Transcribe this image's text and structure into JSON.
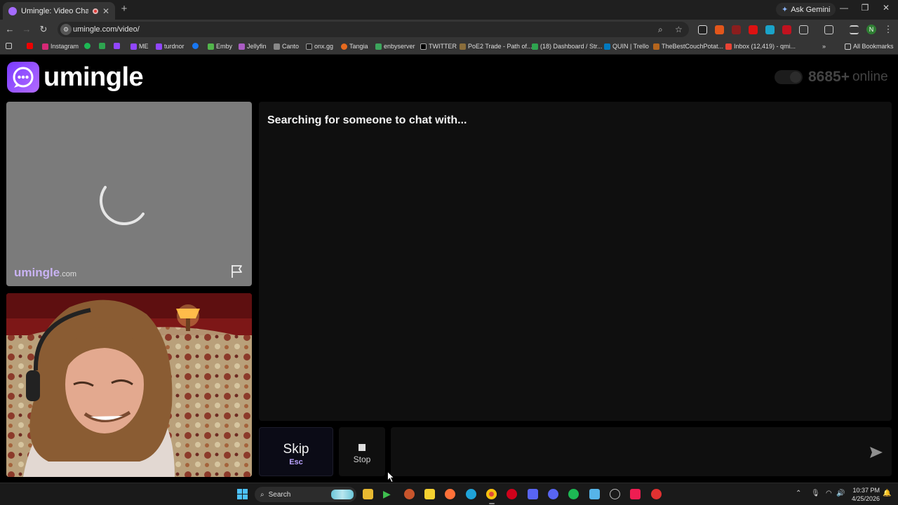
{
  "browser": {
    "tab_title": "Umingle: Video Chat with S",
    "tab_close": "✕",
    "new_tab": "+",
    "ask_gemini": "Ask Gemini",
    "url": "umingle.com/video/",
    "bookmarks": [
      "Instagram",
      "ME",
      "turdnor",
      "Emby",
      "Jellyfin",
      "Canto",
      "onx.gg",
      "Tangia",
      "enbyserver",
      "TWITTER",
      "PoE2 Trade - Path of...",
      "(18) Dashboard / Str...",
      "QUIN | Trello",
      "TheBestCouchPotat...",
      "Inbox (12,419) - qmi..."
    ],
    "all_bookmarks": "All Bookmarks",
    "profile_initial": "N"
  },
  "site": {
    "logo_text": "umingle",
    "online_count": "8685+",
    "online_label": "online"
  },
  "stranger_video": {
    "watermark_name": "umingle",
    "watermark_domain": ".com"
  },
  "chat": {
    "status": "Searching for someone to chat with..."
  },
  "controls": {
    "skip_label": "Skip",
    "skip_key": "Esc",
    "stop_label": "Stop",
    "message_placeholder": ""
  },
  "taskbar": {
    "search_label": "Search",
    "time": "10:37 PM",
    "date": "4/25/2026"
  },
  "colors": {
    "brand_purple": "#8b4dff",
    "skip_key": "#bba4ff",
    "windows_blue": "#4cc2ff"
  }
}
